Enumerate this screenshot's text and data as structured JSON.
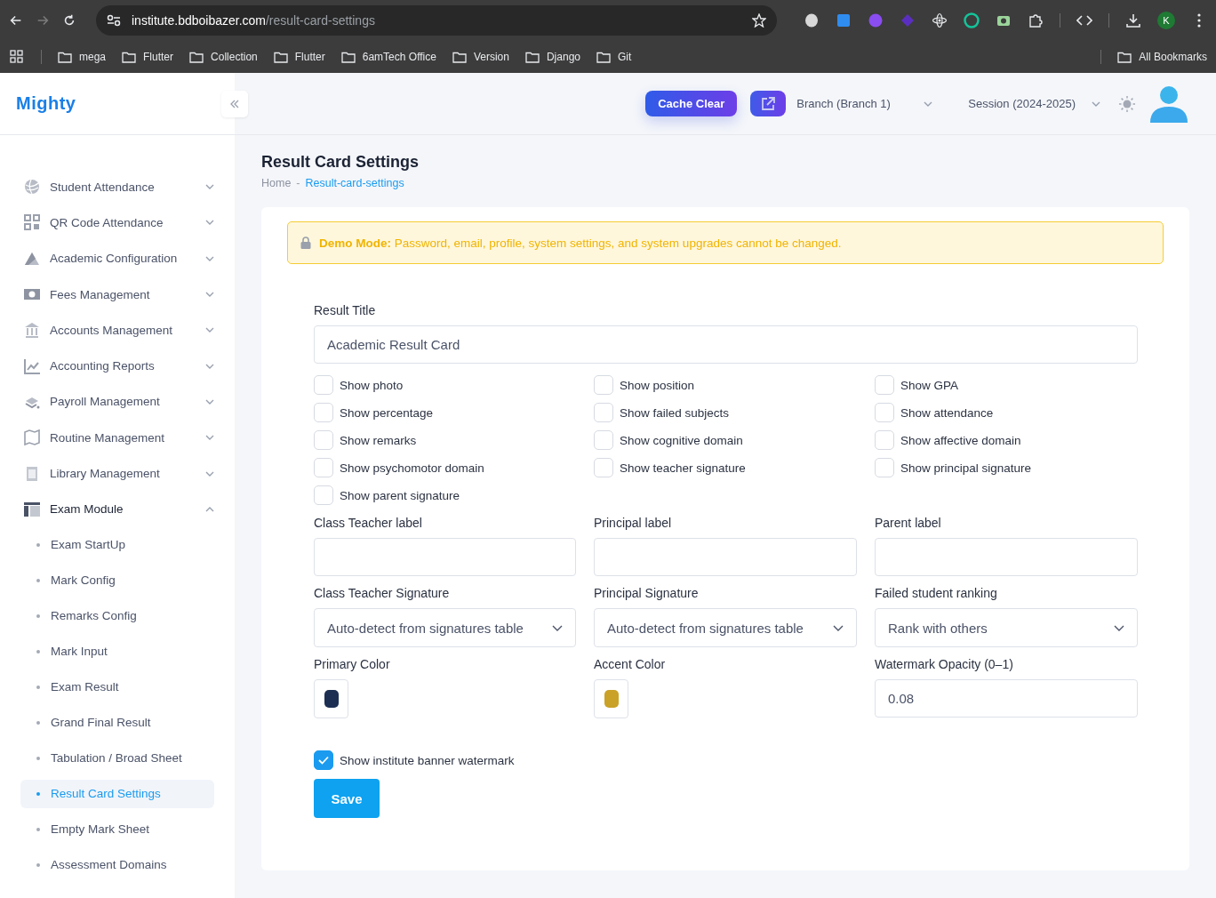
{
  "browser": {
    "url_host": "institute.bdboibazer.com",
    "url_path": "/result-card-settings",
    "profile_initial": "K",
    "bookmarks": [
      "mega",
      "Flutter",
      "Collection",
      "Flutter",
      "6amTech Office",
      "Version",
      "Django",
      "Git"
    ],
    "all_bookmarks": "All Bookmarks"
  },
  "header": {
    "logo": "Mighty",
    "cache_clear": "Cache Clear",
    "branch": "Branch (Branch 1)",
    "session": "Session (2024-2025)"
  },
  "sidebar": {
    "items": [
      {
        "label": "Student Attendance",
        "expanded": false
      },
      {
        "label": "QR Code Attendance",
        "expanded": false
      },
      {
        "label": "Academic Configuration",
        "expanded": false
      },
      {
        "label": "Fees Management",
        "expanded": false
      },
      {
        "label": "Accounts Management",
        "expanded": false
      },
      {
        "label": "Accounting Reports",
        "expanded": false
      },
      {
        "label": "Payroll Management",
        "expanded": false
      },
      {
        "label": "Routine Management",
        "expanded": false
      },
      {
        "label": "Library Management",
        "expanded": false
      },
      {
        "label": "Exam Module",
        "expanded": true,
        "children": [
          {
            "label": "Exam StartUp",
            "selected": false
          },
          {
            "label": "Mark Config",
            "selected": false
          },
          {
            "label": "Remarks Config",
            "selected": false
          },
          {
            "label": "Mark Input",
            "selected": false
          },
          {
            "label": "Exam Result",
            "selected": false
          },
          {
            "label": "Grand Final Result",
            "selected": false
          },
          {
            "label": "Tabulation / Broad Sheet",
            "selected": false
          },
          {
            "label": "Result Card Settings",
            "selected": true
          },
          {
            "label": "Empty Mark Sheet",
            "selected": false
          },
          {
            "label": "Assessment Domains",
            "selected": false
          }
        ]
      }
    ]
  },
  "page": {
    "title": "Result Card Settings",
    "breadcrumb": [
      "Home",
      "Result-card-settings"
    ],
    "breadcrumb_separator": "-"
  },
  "alert": {
    "text": "**Demo Mode:** Password, email, profile, system settings, and system upgrades cannot be changed."
  },
  "form": {
    "result_title": {
      "label": "Result Title",
      "value": "Academic Result Card"
    },
    "checkboxes": [
      {
        "label": "Show photo",
        "checked": false
      },
      {
        "label": "Show position",
        "checked": false
      },
      {
        "label": "Show GPA",
        "checked": false
      },
      {
        "label": "Show percentage",
        "checked": false
      },
      {
        "label": "Show failed subjects",
        "checked": false
      },
      {
        "label": "Show attendance",
        "checked": false
      },
      {
        "label": "Show remarks",
        "checked": false
      },
      {
        "label": "Show cognitive domain",
        "checked": false
      },
      {
        "label": "Show affective domain",
        "checked": false
      },
      {
        "label": "Show psychomotor domain",
        "checked": false
      },
      {
        "label": "Show teacher signature",
        "checked": false
      },
      {
        "label": "Show principal signature",
        "checked": false
      },
      {
        "label": "Show parent signature",
        "checked": false
      }
    ],
    "fields": [
      {
        "kind": "text",
        "label": "Class Teacher label"
      },
      {
        "kind": "text",
        "label": "Principal label"
      },
      {
        "kind": "text",
        "label": "Parent label"
      },
      {
        "kind": "select",
        "label": "Class Teacher Signature",
        "value": "Auto-detect from signatures table"
      },
      {
        "kind": "select",
        "label": "Principal Signature",
        "value": "Auto-detect from signatures table"
      },
      {
        "kind": "select",
        "label": "Failed student ranking",
        "value": "Rank with others"
      },
      {
        "kind": "color",
        "label": "Primary Color",
        "color": "#1c2f52"
      },
      {
        "kind": "color",
        "label": "Accent Color",
        "color": "#c9a227"
      },
      {
        "kind": "text",
        "label": "Watermark Opacity (0–1)",
        "value": "0.08"
      }
    ],
    "watermark": {
      "label": "Show institute banner watermark",
      "checked": true
    },
    "save": "Save"
  }
}
